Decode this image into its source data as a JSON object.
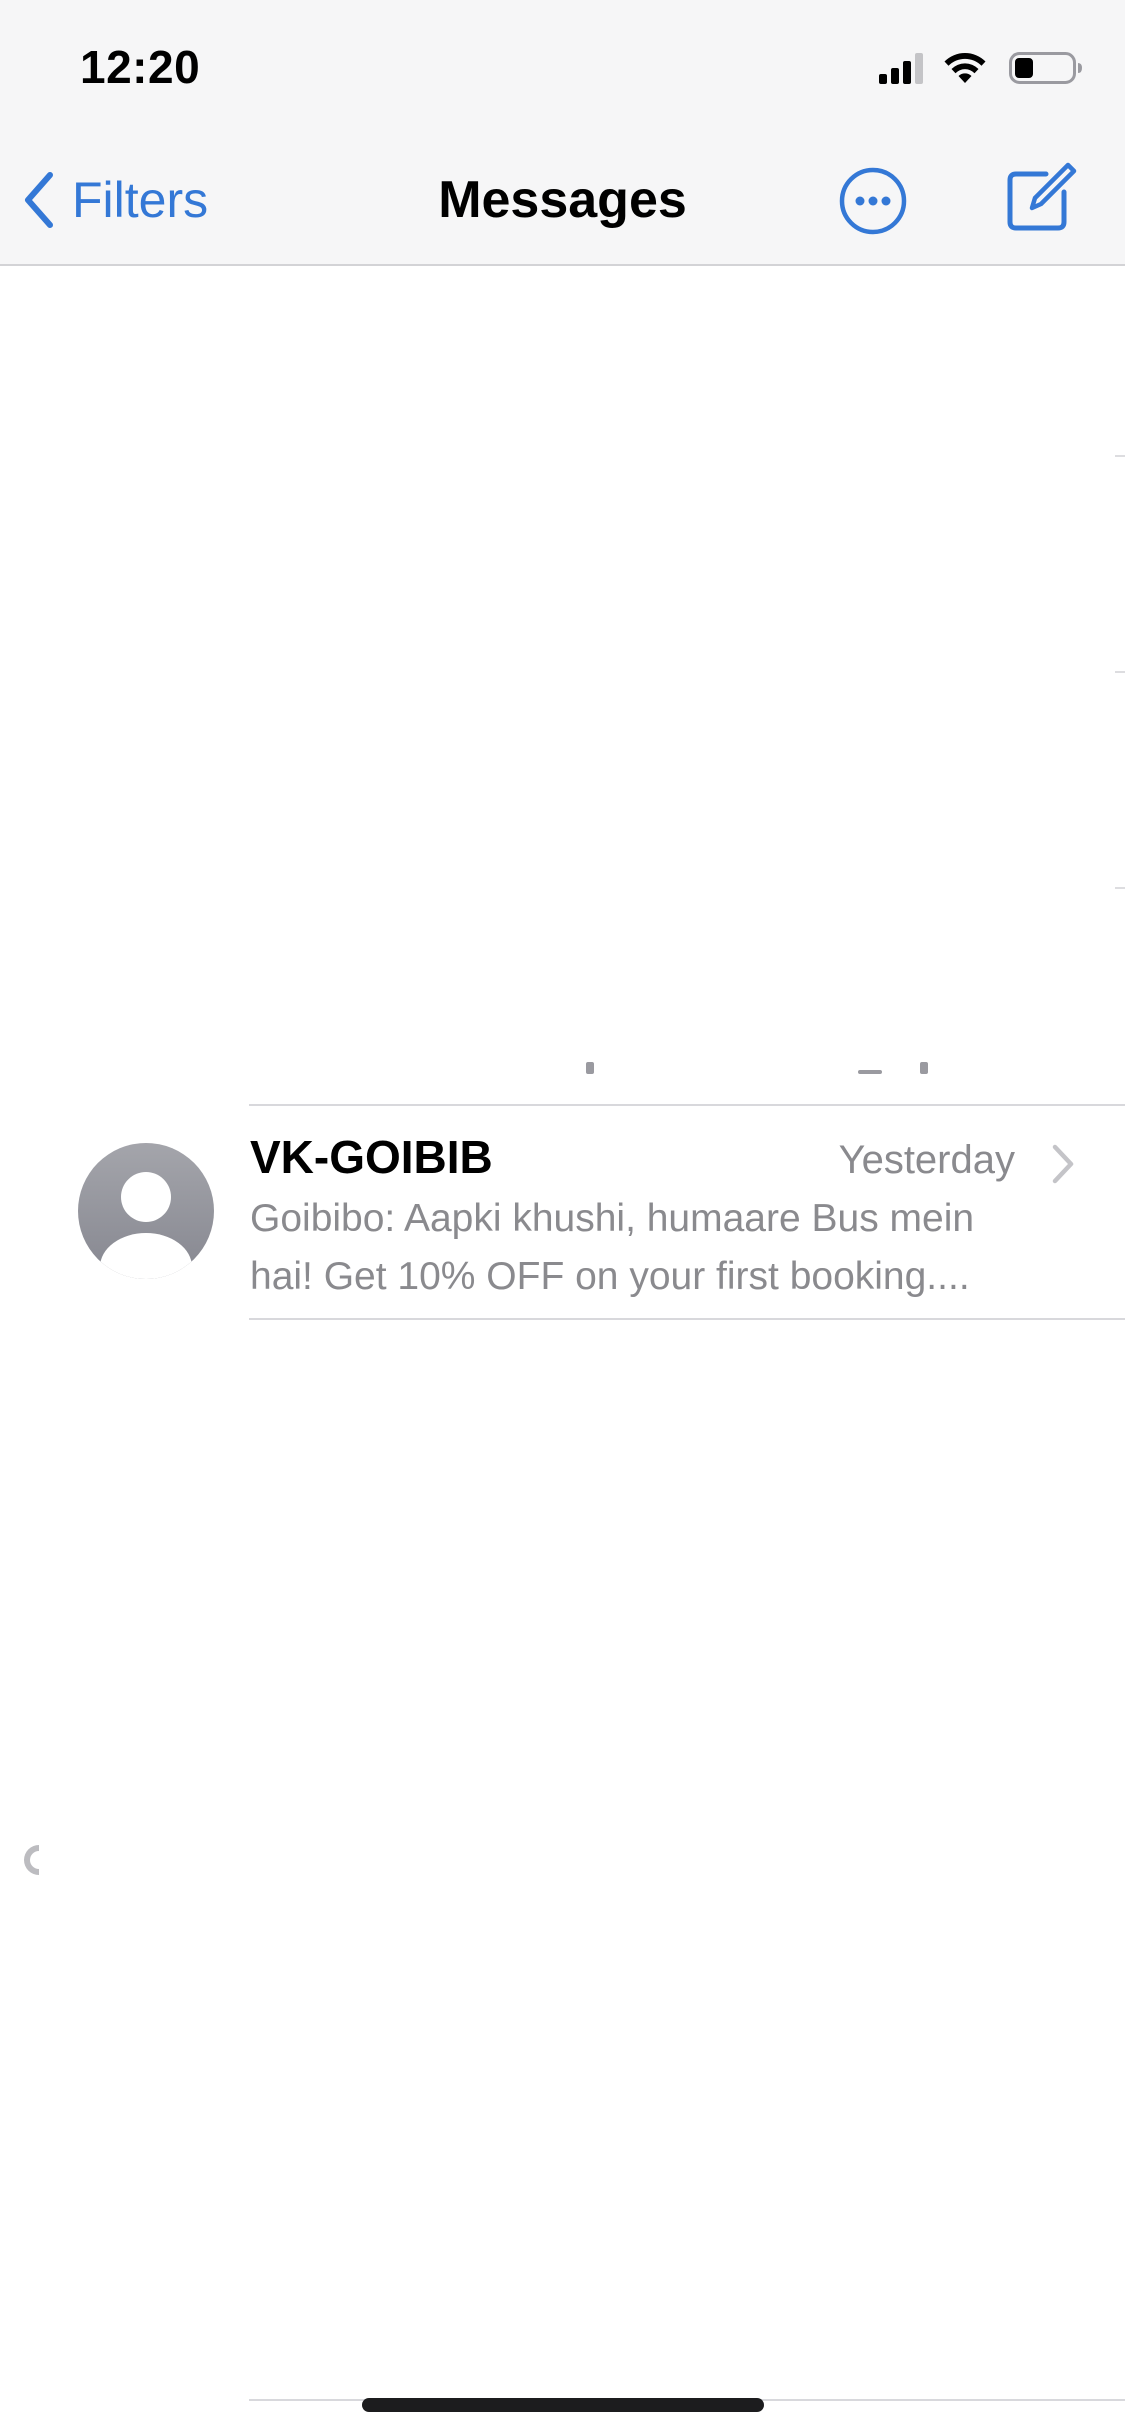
{
  "status_bar": {
    "time": "12:20",
    "icons": [
      "cellular-signal-icon",
      "wifi-icon",
      "battery-icon"
    ]
  },
  "nav": {
    "back_label": "Filters",
    "title": "Messages",
    "back_icon": "chevron-left-icon",
    "more_icon": "ellipsis-circle-icon",
    "compose_icon": "compose-icon"
  },
  "conversations": [
    {
      "sender": "VK-GOIBIB",
      "timestamp": "Yesterday",
      "preview_line1": "Goibibo: Aapki khushi, humaare Bus mein",
      "preview_line2": "hai! Get 10% OFF on your first booking....",
      "avatar_icon": "person-avatar-icon"
    }
  ],
  "colors": {
    "accent": "#3478d6",
    "secondary_text": "#8a8a8e",
    "bar_background": "#f6f6f7",
    "separator": "#d8d8dc"
  }
}
